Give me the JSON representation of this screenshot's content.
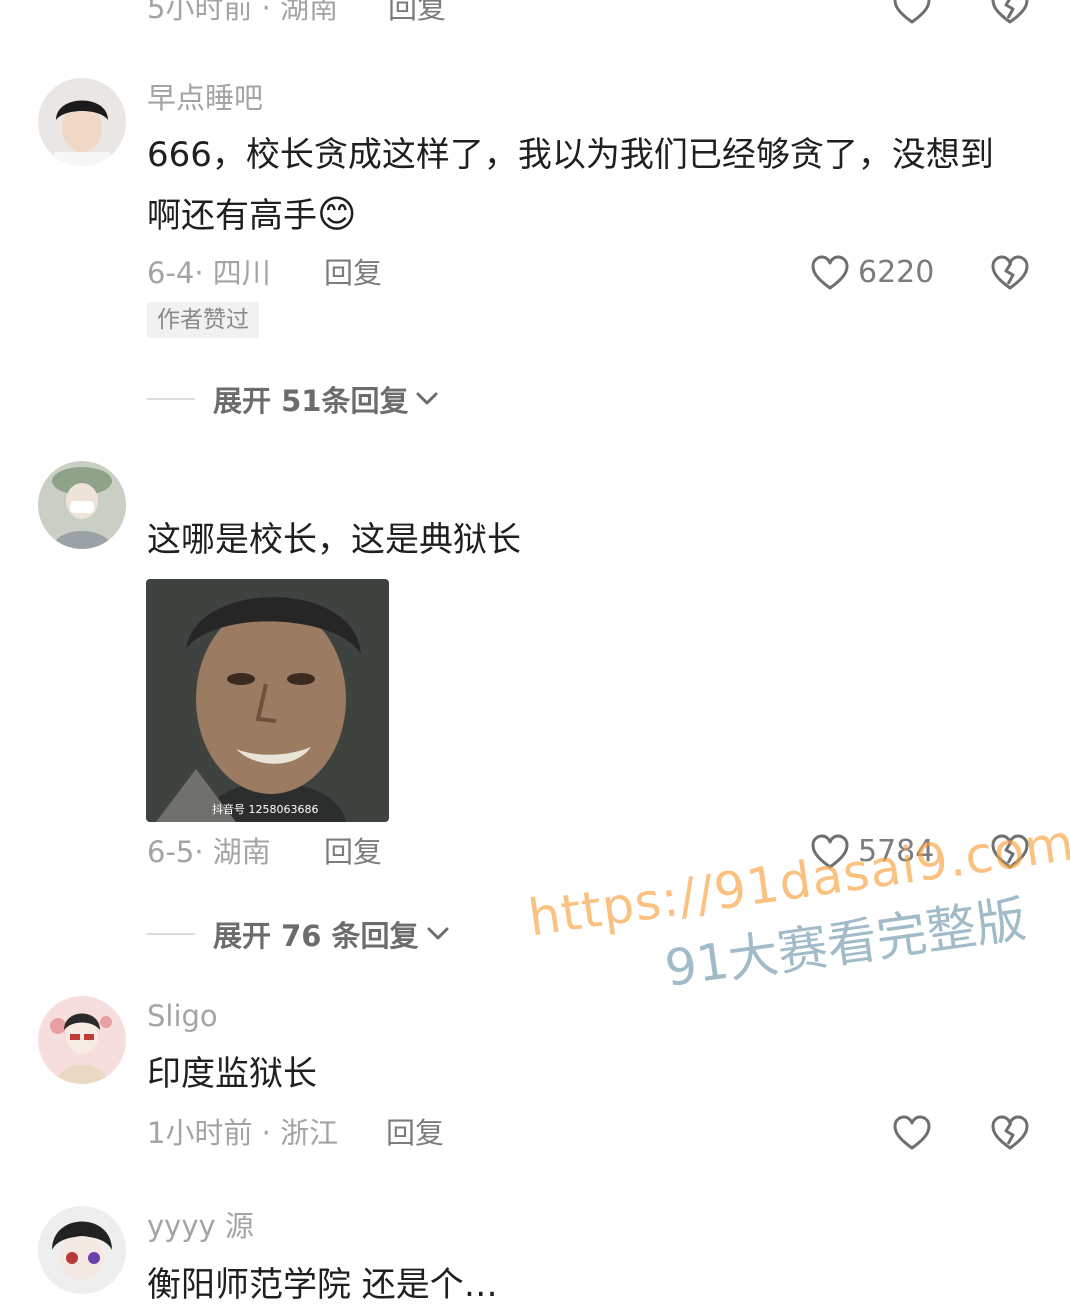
{
  "top_partial": {
    "time_location": "5小时前 · 湖南",
    "reply_label": "回复"
  },
  "comments": [
    {
      "username": "早点睡吧",
      "text": "666，校长贪成这样了，我以为我们已经够贪了，没想到啊还有高手",
      "emoji": "😊",
      "time_location": "6-4· 四川",
      "reply_label": "回复",
      "likes": "6220",
      "badge": "作者赞过",
      "expand_label": "展开 51条回复"
    },
    {
      "username": "",
      "text": "这哪是校长，这是典狱长",
      "image_caption": "抖音号 1258063686",
      "time_location": "6-5· 湖南",
      "reply_label": "回复",
      "likes": "5784",
      "expand_label": "展开 76 条回复"
    },
    {
      "username": "Sligo",
      "text": "印度监狱长",
      "time_location": "1小时前 · 浙江",
      "reply_label": "回复"
    },
    {
      "username": "yyyy 源",
      "text": "衡阳师范学院 还是个…"
    }
  ],
  "watermark": {
    "url": "https://91dasai9.com",
    "subtitle": "91大赛看完整版"
  },
  "colors": {
    "meta": "#a4a4a4",
    "text": "#1f1f1f",
    "icon": "#6f6f6f"
  },
  "icons": [
    "heart-outline-icon",
    "broken-heart-icon",
    "chevron-down-icon"
  ]
}
